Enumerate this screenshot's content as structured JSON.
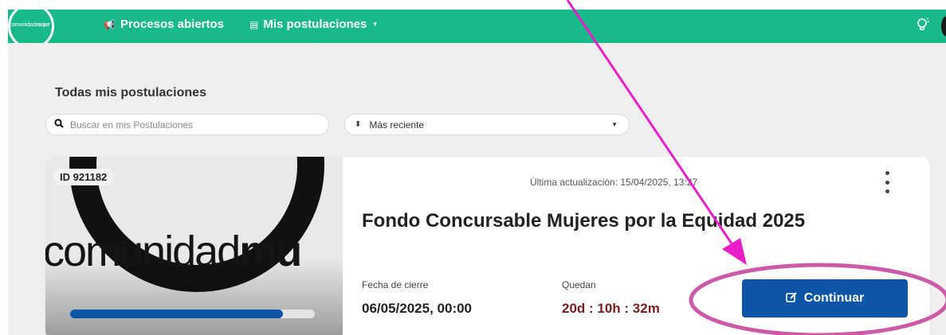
{
  "navbar": {
    "logo_text_light": "comunidad",
    "logo_text_bold": "mujer",
    "items": [
      {
        "icon": "megaphone-icon",
        "glyph": "📢",
        "label": "Procesos abiertos",
        "has_caret": false
      },
      {
        "icon": "clipboard-icon",
        "glyph": "▤",
        "label": "Mis postulaciones",
        "has_caret": true
      }
    ],
    "right_icon": "lightbulb-icon"
  },
  "main": {
    "heading": "Todas mis postulaciones",
    "search": {
      "placeholder": "Buscar en mis Postulaciones",
      "value": ""
    },
    "sort": {
      "selected": "Más reciente"
    }
  },
  "card": {
    "id_badge": "ID 921182",
    "image_word_light": "comunidad",
    "image_word_bold": "mu",
    "progress_fraction": 0.87,
    "last_updated": "Última actualización: 15/04/2025, 13:27",
    "title": "Fondo Concursable Mujeres por la Equidad 2025",
    "deadline_label": "Fecha de cierre",
    "deadline_value": "06/05/2025, 00:00",
    "remaining_label": "Quedan",
    "remaining_value": "20d : 10h : 32m",
    "button_label": "Continuar"
  },
  "colors": {
    "navbar": "#18b98a",
    "primary": "#0d55a6",
    "countdown": "#7a1b1b",
    "annotation_arrow": "#e81fc8",
    "annotation_ellipse": "#cc5aa8"
  }
}
